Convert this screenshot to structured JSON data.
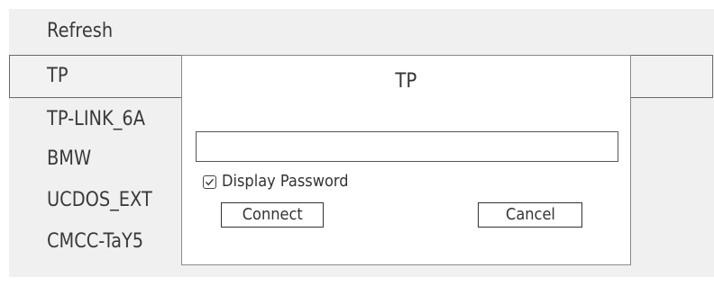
{
  "wifi_list": {
    "refresh_label": "Refresh",
    "networks": [
      "TP",
      "TP-LINK_6A",
      "BMW",
      "UCDOS_EXT",
      "CMCC-TaY5"
    ],
    "selected": "TP"
  },
  "dialog": {
    "title": "TP",
    "password_value": "",
    "password_placeholder": "",
    "display_password_label": "Display Password",
    "display_password_checked": true,
    "connect_label": "Connect",
    "cancel_label": "Cancel"
  },
  "colors": {
    "panel_background": "#f0f0f0",
    "dialog_background": "#ffffff",
    "border": "#555555",
    "text": "#3a3a3a"
  }
}
